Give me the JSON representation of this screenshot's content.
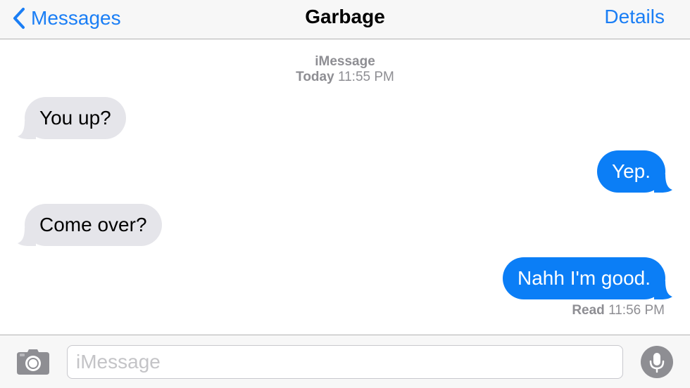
{
  "navbar": {
    "back_label": "Messages",
    "title": "Garbage",
    "details_label": "Details",
    "back_icon": "chevron-left-icon"
  },
  "conversation": {
    "service": "iMessage",
    "timestamp_day": "Today",
    "timestamp_time": "11:55 PM",
    "messages": [
      {
        "direction": "received",
        "text": "You up?"
      },
      {
        "direction": "sent",
        "text": "Yep."
      },
      {
        "direction": "received",
        "text": "Come over?"
      },
      {
        "direction": "sent",
        "text": "Nahh I'm good."
      }
    ],
    "read_label": "Read",
    "read_time": "11:56 PM"
  },
  "input_bar": {
    "placeholder": "iMessage",
    "camera_icon": "camera-icon",
    "mic_icon": "microphone-icon"
  },
  "colors": {
    "accent": "#1a7ef5",
    "sent_bubble": "#0b7ef6",
    "received_bubble": "#e5e5ea",
    "secondary_text": "#8e8e93"
  }
}
